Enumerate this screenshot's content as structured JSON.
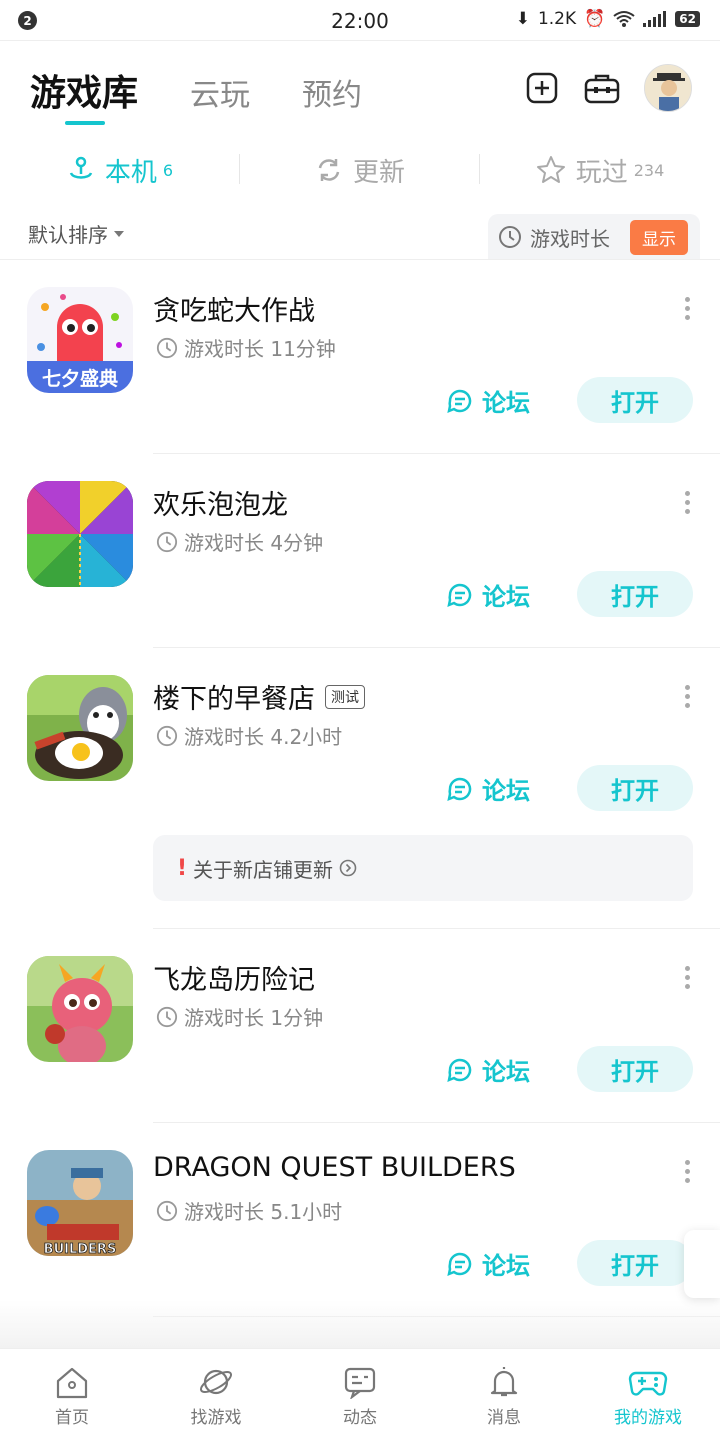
{
  "status_bar": {
    "notification_count": "2",
    "time": "22:00",
    "net_speed": "1.2K",
    "battery": "62"
  },
  "top_tabs": [
    {
      "label": "游戏库"
    },
    {
      "label": "云玩"
    },
    {
      "label": "预约"
    }
  ],
  "sub_tabs": [
    {
      "label": "本机",
      "count": "6"
    },
    {
      "label": "更新",
      "count": ""
    },
    {
      "label": "玩过",
      "count": "234"
    }
  ],
  "sort_label": "默认排序",
  "duration_label": "游戏时长",
  "show_label": "显示",
  "games": [
    {
      "title": "贪吃蛇大作战",
      "tag": "",
      "time": "游戏时长 11分钟",
      "forum": "论坛",
      "open": "打开",
      "icon_text": "七夕盛典"
    },
    {
      "title": "欢乐泡泡龙",
      "tag": "",
      "time": "游戏时长 4分钟",
      "forum": "论坛",
      "open": "打开",
      "icon_text": ""
    },
    {
      "title": "楼下的早餐店",
      "tag": "测试",
      "time": "游戏时长 4.2小时",
      "forum": "论坛",
      "open": "打开",
      "icon_text": ""
    },
    {
      "title": "飞龙岛历险记",
      "tag": "",
      "time": "游戏时长 1分钟",
      "forum": "论坛",
      "open": "打开",
      "icon_text": ""
    },
    {
      "title": "DRAGON QUEST BUILDERS",
      "tag": "",
      "time": "游戏时长 5.1小时",
      "forum": "论坛",
      "open": "打开",
      "icon_text": "BUILDERS"
    }
  ],
  "notice": "关于新店铺更新",
  "bottom_nav": [
    {
      "label": "首页",
      "icon": "home-icon"
    },
    {
      "label": "找游戏",
      "icon": "planet-icon"
    },
    {
      "label": "动态",
      "icon": "message-icon"
    },
    {
      "label": "消息",
      "icon": "bell-icon"
    },
    {
      "label": "我的游戏",
      "icon": "gamepad-icon",
      "active": true
    }
  ],
  "colors": {
    "accent": "#15c5ce",
    "show_button": "#fa7b45",
    "warning": "#f04848"
  }
}
